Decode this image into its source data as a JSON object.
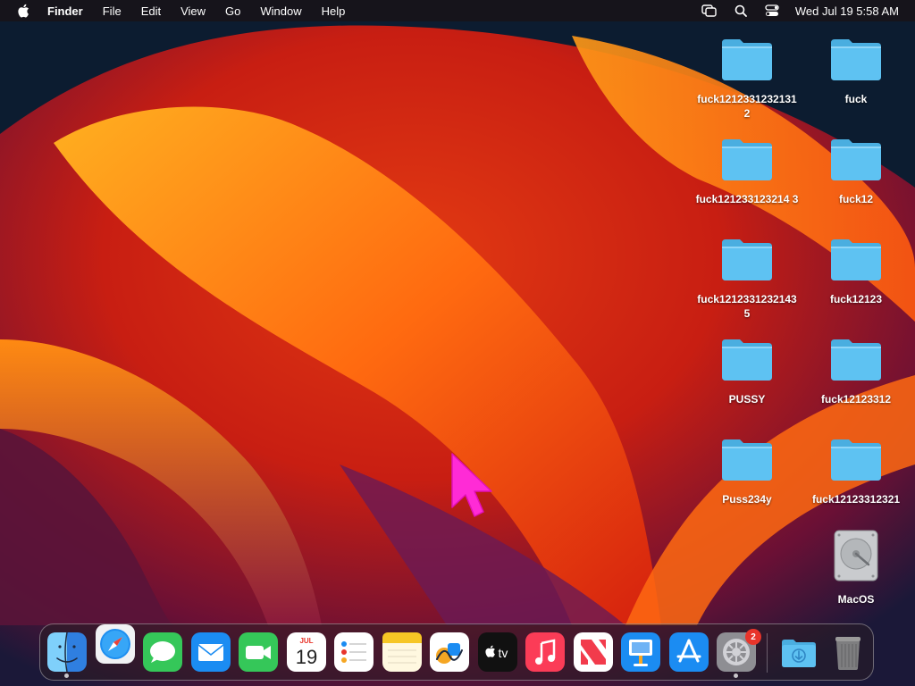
{
  "menubar": {
    "app_name": "Finder",
    "menus": [
      "File",
      "Edit",
      "View",
      "Go",
      "Window",
      "Help"
    ],
    "clock": "Wed Jul 19  5:58 AM",
    "status_icons": [
      "screen-mirroring-icon",
      "spotlight-search-icon",
      "control-center-icon"
    ]
  },
  "desktop": {
    "items": [
      {
        "label": "fuck12123312321312",
        "icon": "folder-icon"
      },
      {
        "label": "fuck",
        "icon": "folder-icon"
      },
      {
        "label": "fuck121233123214 3",
        "icon": "folder-icon"
      },
      {
        "label": "fuck12",
        "icon": "folder-icon"
      },
      {
        "label": "fuck12123312321435",
        "icon": "folder-icon"
      },
      {
        "label": "fuck12123",
        "icon": "folder-icon"
      },
      {
        "label": "PUSSY",
        "icon": "folder-icon"
      },
      {
        "label": "fuck12123312",
        "icon": "folder-icon"
      },
      {
        "label": "Puss234y",
        "icon": "folder-icon"
      },
      {
        "label": "fuck12123312321",
        "icon": "folder-icon"
      },
      {
        "label": "MacOS",
        "icon": "hard-drive-icon"
      }
    ]
  },
  "dock": {
    "apps": [
      {
        "name": "Finder",
        "icon": "finder-icon",
        "running": true
      },
      {
        "name": "Safari",
        "icon": "safari-icon",
        "running": false
      },
      {
        "name": "Messages",
        "icon": "messages-icon",
        "running": false
      },
      {
        "name": "Mail",
        "icon": "mail-icon",
        "running": false
      },
      {
        "name": "FaceTime",
        "icon": "facetime-icon",
        "running": false
      },
      {
        "name": "Calendar",
        "icon": "calendar-icon",
        "running": false,
        "month": "JUL",
        "day": "19"
      },
      {
        "name": "Reminders",
        "icon": "reminders-icon",
        "running": false
      },
      {
        "name": "Notes",
        "icon": "notes-icon",
        "running": false
      },
      {
        "name": "Freeform",
        "icon": "freeform-icon",
        "running": false
      },
      {
        "name": "TV",
        "icon": "apple-tv-icon",
        "running": false,
        "label": "tv"
      },
      {
        "name": "Music",
        "icon": "music-icon",
        "running": false
      },
      {
        "name": "News",
        "icon": "news-icon",
        "running": false
      },
      {
        "name": "Keynote",
        "icon": "keynote-icon",
        "running": false
      },
      {
        "name": "App Store",
        "icon": "app-store-icon",
        "running": false
      },
      {
        "name": "System Settings",
        "icon": "settings-icon",
        "running": true,
        "badge": "2"
      }
    ],
    "downloads": {
      "name": "Downloads",
      "icon": "downloads-folder-icon"
    },
    "trash": {
      "name": "Trash",
      "icon": "trash-icon"
    }
  },
  "colors": {
    "folder": "#5ec2f2",
    "folder_tab": "#4aaee0",
    "badge": "#e8342a",
    "cursor": "#ff2bd6"
  }
}
